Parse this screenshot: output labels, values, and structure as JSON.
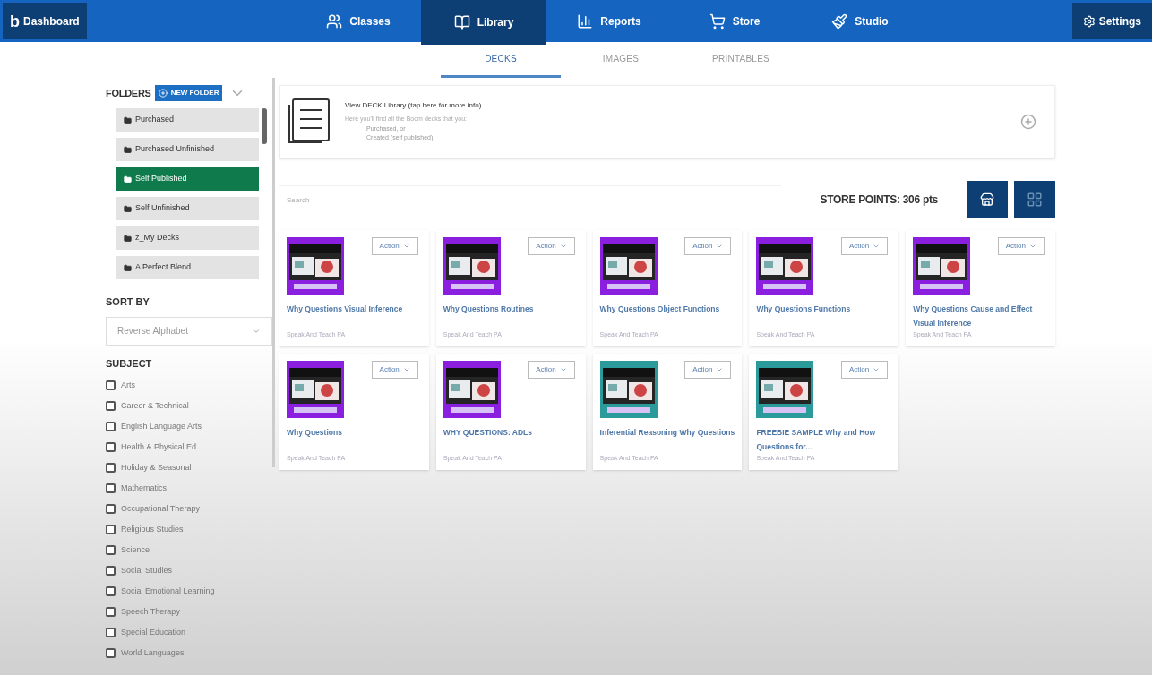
{
  "nav": {
    "logo": "b",
    "home": "Dashboard",
    "tabs": [
      {
        "label": "Classes",
        "selected": false
      },
      {
        "label": "Library",
        "selected": true
      },
      {
        "label": "Reports",
        "selected": false
      },
      {
        "label": "Store",
        "selected": false
      },
      {
        "label": "Studio",
        "selected": false
      }
    ],
    "settings": "Settings"
  },
  "subtabs": [
    {
      "label": "DECKS",
      "selected": true
    },
    {
      "label": "IMAGES",
      "selected": false
    },
    {
      "label": "PRINTABLES",
      "selected": false
    }
  ],
  "sidebar": {
    "folders_title": "FOLDERS",
    "new_folder": "NEW FOLDER",
    "folders": [
      {
        "label": "Purchased",
        "selected": false
      },
      {
        "label": "Purchased Unfinished",
        "selected": false
      },
      {
        "label": "Self Published",
        "selected": true
      },
      {
        "label": "Self Unfinished",
        "selected": false
      },
      {
        "label": "z_My Decks",
        "selected": false
      },
      {
        "label": "A Perfect Blend",
        "selected": false
      }
    ],
    "sort_title": "SORT BY",
    "sort_value": "Reverse Alphabet",
    "subject_title": "SUBJECT",
    "subjects": [
      {
        "label": "Arts",
        "checked": false
      },
      {
        "label": "Career & Technical",
        "checked": false
      },
      {
        "label": "English Language Arts",
        "checked": false
      },
      {
        "label": "Health & Physical Ed",
        "checked": false
      },
      {
        "label": "Holiday & Seasonal",
        "checked": false
      },
      {
        "label": "Mathematics",
        "checked": false
      },
      {
        "label": "Occupational Therapy",
        "checked": false
      },
      {
        "label": "Religious Studies",
        "checked": false
      },
      {
        "label": "Science",
        "checked": false
      },
      {
        "label": "Social Studies",
        "checked": false
      },
      {
        "label": "Social Emotional Learning",
        "checked": false
      },
      {
        "label": "Speech Therapy",
        "checked": false
      },
      {
        "label": "Special Education",
        "checked": false
      },
      {
        "label": "World Languages",
        "checked": false
      }
    ]
  },
  "info": {
    "title": "View DECK Library (tap here for more info)",
    "text": "Here you'll find all the Boom decks that you:",
    "lines": [
      "Purchased, or",
      "Created (self published)."
    ]
  },
  "search": {
    "placeholder": "Search"
  },
  "store_points": "STORE POINTS: 306 pts",
  "decks": [
    {
      "title": "Why Questions Visual Inference",
      "author": "Speak And Teach PA",
      "action": "Action",
      "color": "#8a1fe0"
    },
    {
      "title": "Why Questions Routines",
      "author": "Speak And Teach PA",
      "action": "Action",
      "color": "#8a1fe0"
    },
    {
      "title": "Why Questions Object Functions",
      "author": "Speak And Teach PA",
      "action": "Action",
      "color": "#8a1fe0"
    },
    {
      "title": "Why Questions Functions",
      "author": "Speak And Teach PA",
      "action": "Action",
      "color": "#8a1fe0"
    },
    {
      "title": "Why Questions Cause and Effect Visual Inference",
      "author": "Speak And Teach PA",
      "action": "Action",
      "color": "#8a1fe0"
    },
    {
      "title": "Why Questions",
      "author": "Speak And Teach PA",
      "action": "Action",
      "color": "#8a1fe0"
    },
    {
      "title": "WHY QUESTIONS: ADLs",
      "author": "Speak And Teach PA",
      "action": "Action",
      "color": "#8a1fe0"
    },
    {
      "title": "Inferential Reasoning Why Questions",
      "author": "Speak And Teach PA",
      "action": "Action",
      "color": "#2a9a9a"
    },
    {
      "title": "FREEBIE SAMPLE Why and How Questions for...",
      "author": "Speak And Teach PA",
      "action": "Action",
      "color": "#2a9a9a"
    }
  ]
}
